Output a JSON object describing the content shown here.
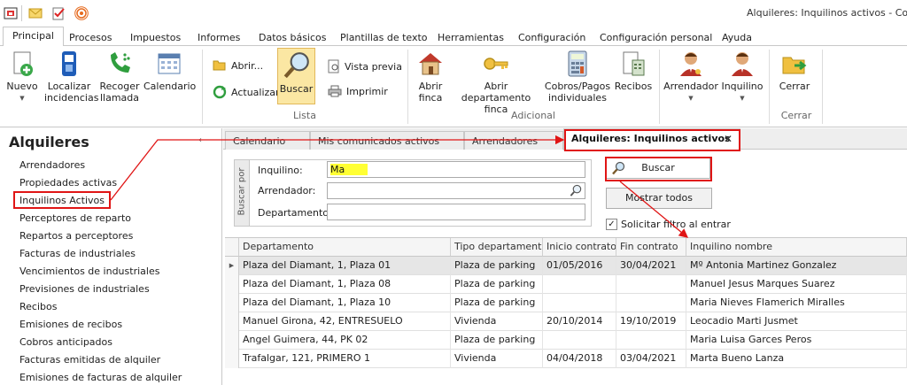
{
  "window": {
    "title": "Alquileres: Inquilinos activos - Consola"
  },
  "quick_access": [
    {
      "name": "app-icon"
    },
    {
      "name": "mail-icon"
    },
    {
      "name": "tasks-icon"
    },
    {
      "name": "broadcast-icon"
    }
  ],
  "menu_tabs": [
    "Principal",
    "Procesos",
    "Impuestos",
    "Informes",
    "Datos básicos",
    "Plantillas de texto",
    "Herramientas",
    "Configuración",
    "Configuración personal",
    "Ayuda"
  ],
  "ribbon": {
    "nuevo": "Nuevo",
    "localizar": "Localizar incidencias",
    "recoger": "Recoger llamada",
    "calendario": "Calendario",
    "abrir": "Abrir...",
    "actualizar": "Actualizar",
    "buscar": "Buscar",
    "vista_previa": "Vista previa",
    "imprimir": "Imprimir",
    "lista_label": "Lista",
    "abrir_finca": "Abrir finca",
    "abrir_depto": "Abrir departamento finca",
    "cobros": "Cobros/Pagos individuales",
    "recibos": "Recibos",
    "adicional_label": "Adicional",
    "arrendador": "Arrendador",
    "inquilino": "Inquilino",
    "cerrar": "Cerrar",
    "cerrar_label": "Cerrar"
  },
  "sidebar": {
    "title": "Alquileres",
    "items": [
      "Arrendadores",
      "Propiedades activas",
      "Inquilinos Activos",
      "Perceptores de reparto",
      "Repartos a perceptores",
      "Facturas de industriales",
      "Vencimientos de industriales",
      "Previsiones de industriales",
      "Recibos",
      "Emisiones de recibos",
      "Cobros anticipados",
      "Facturas emitidas de alquiler",
      "Emisiones de facturas de alquiler"
    ]
  },
  "doc_tabs": [
    "Calendario",
    "Mis comunicados activos",
    "Arrendadores",
    "Alquileres: Inquilinos activos"
  ],
  "search": {
    "vertical_label": "Buscar por",
    "inquilino_label": "Inquilino:",
    "inquilino_value": "Ma",
    "arrendador_label": "Arrendador:",
    "arrendador_value": "",
    "departamento_label": "Departamento:",
    "departamento_value": "",
    "buscar_button": "Buscar",
    "mostrar_todos_button": "Mostrar todos",
    "solicitar_filtro_label": "Solicitar filtro al entrar",
    "solicitar_filtro_checked": true
  },
  "grid": {
    "columns": [
      "Departamento",
      "Tipo departamento",
      "Inicio contrato",
      "Fin contrato",
      "Inquilino nombre"
    ],
    "rows": [
      [
        "Plaza del Diamant, 1, Plaza 01",
        "Plaza de parking",
        "01/05/2016",
        "30/04/2021",
        "Mº Antonia Martinez Gonzalez"
      ],
      [
        "Plaza del Diamant, 1, Plaza 08",
        "Plaza de parking",
        "",
        "",
        "Manuel Jesus Marques Suarez"
      ],
      [
        "Plaza del Diamant, 1, Plaza 10",
        "Plaza de parking",
        "",
        "",
        "Maria Nieves Flamerich Miralles"
      ],
      [
        "Manuel Girona, 42, ENTRESUELO",
        "Vivienda",
        "20/10/2014",
        "19/10/2019",
        "Leocadio Marti Jusmet"
      ],
      [
        "Angel Guimera, 44, PK 02",
        "Plaza de parking",
        "",
        "",
        "Maria Luisa Garces Peros"
      ],
      [
        "Trafalgar, 121, PRIMERO 1",
        "Vivienda",
        "04/04/2018",
        "03/04/2021",
        "Marta Bueno Lanza"
      ]
    ]
  },
  "colors": {
    "annotation_red": "#e01515",
    "highlight_yellow": "#ffff33",
    "ribbon_active": "#fbe7a3"
  }
}
